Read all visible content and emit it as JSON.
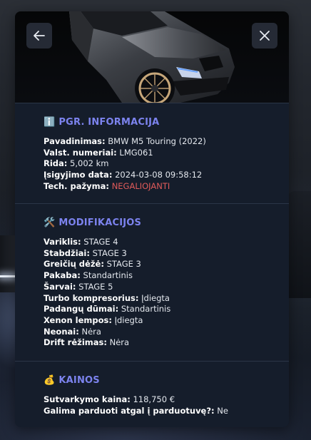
{
  "colors": {
    "accent": "#7c83ee",
    "danger": "#e05a5a",
    "panel_bg": "#151d2b"
  },
  "header": {
    "back_icon": "arrow-left-icon",
    "close_icon": "close-icon"
  },
  "sections": {
    "basic": {
      "icon": "ℹ️",
      "title": "PGR. INFORMACIJA",
      "rows": [
        {
          "label": "Pavadinimas:",
          "value": "BMW M5 Touring (2022)"
        },
        {
          "label": "Valst. numeriai:",
          "value": "LMG061"
        },
        {
          "label": "Rida:",
          "value": "5,002 km"
        },
        {
          "label": "Įsigyjimo data:",
          "value": "2024-03-08 09:58:12"
        },
        {
          "label": "Tech. pažyma:",
          "value": "NEGALIOJANTI"
        }
      ]
    },
    "mods": {
      "icon": "🛠️",
      "title": "MODIFIKACIJOS",
      "rows": [
        {
          "label": "Variklis:",
          "value": "STAGE 4"
        },
        {
          "label": "Stabdžiai:",
          "value": "STAGE 3"
        },
        {
          "label": "Greičių dėžė:",
          "value": "STAGE 3"
        },
        {
          "label": "Pakaba:",
          "value": "Standartinis"
        },
        {
          "label": "Šarvai:",
          "value": "STAGE 5"
        },
        {
          "label": "Turbo kompresorius:",
          "value": "Įdiegta"
        },
        {
          "label": "Padangų dūmai:",
          "value": "Standartinis"
        },
        {
          "label": "Xenon lempos:",
          "value": "Įdiegta"
        },
        {
          "label": "Neonai:",
          "value": "Nėra"
        },
        {
          "label": "Drift rėžimas:",
          "value": "Nėra"
        }
      ]
    },
    "prices": {
      "icon": "💰",
      "title": "KAINOS",
      "rows": [
        {
          "label": "Sutvarkymo kaina:",
          "value": "118,750 €"
        },
        {
          "label": "Galima parduoti atgal į parduotuvę?:",
          "value": "Ne"
        }
      ]
    }
  }
}
